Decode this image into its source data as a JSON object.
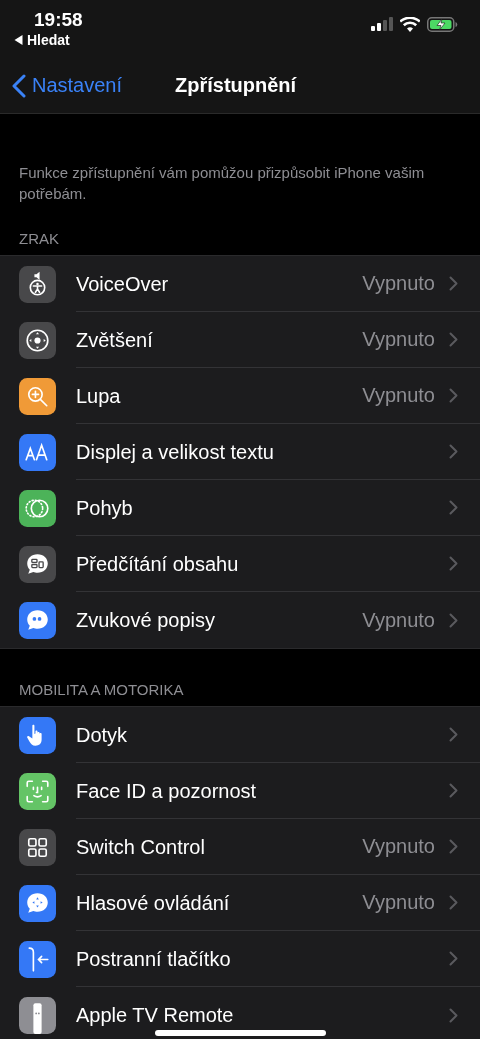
{
  "status_bar": {
    "time": "19:58",
    "back_link": "Hledat"
  },
  "nav": {
    "back": "Nastavení",
    "title": "Zpřístupnění"
  },
  "description": "Funkce zpřístupnění vám pomůžou přizpůsobit iPhone vašim potřebám.",
  "sections": [
    {
      "header": "ZRAK",
      "items": [
        {
          "label": "VoiceOver",
          "value": "Vypnuto",
          "color": "#48484a"
        },
        {
          "label": "Zvětšení",
          "value": "Vypnuto",
          "color": "#48484a"
        },
        {
          "label": "Lupa",
          "value": "Vypnuto",
          "color": "#f09a37"
        },
        {
          "label": "Displej a velikost textu",
          "color": "#3478f6"
        },
        {
          "label": "Pohyb",
          "color": "#4cb359"
        },
        {
          "label": "Předčítání obsahu",
          "color": "#48484a"
        },
        {
          "label": "Zvukové popisy",
          "value": "Vypnuto",
          "color": "#3478f6"
        }
      ]
    },
    {
      "header": "MOBILITA A MOTORIKA",
      "items": [
        {
          "label": "Dotyk",
          "color": "#3478f6"
        },
        {
          "label": "Face ID a pozornost",
          "color": "#64c466"
        },
        {
          "label": "Switch Control",
          "value": "Vypnuto",
          "color": "#48484a"
        },
        {
          "label": "Hlasové ovládání",
          "value": "Vypnuto",
          "color": "#3478f6"
        },
        {
          "label": "Postranní tlačítko",
          "color": "#3478f6"
        },
        {
          "label": "Apple TV Remote",
          "color": "#8e8e93"
        }
      ]
    }
  ]
}
